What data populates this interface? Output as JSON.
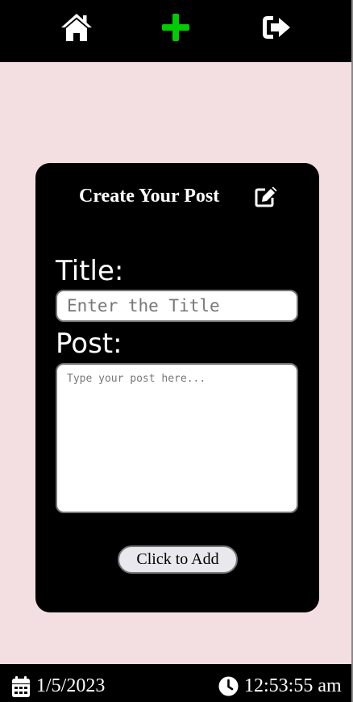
{
  "nav": {
    "icons": [
      "home-icon",
      "plus-icon",
      "sign-out-icon"
    ],
    "plus_color": "#00cc00"
  },
  "form": {
    "heading": "Create Your Post",
    "title_label": "Title:",
    "title_placeholder": "Enter the Title",
    "post_label": "Post:",
    "post_placeholder": "Type your post here...",
    "submit_label": "Click to Add"
  },
  "footer": {
    "date": "1/5/2023",
    "time": "12:53:55 am"
  },
  "colors": {
    "background": "#f3dfe2",
    "bars": "#000000",
    "card": "#000000"
  }
}
